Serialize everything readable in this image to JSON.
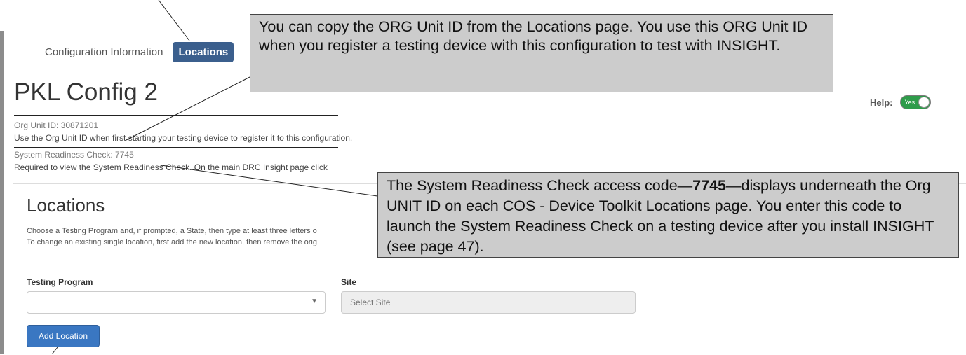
{
  "tabs": [
    {
      "label": "Configuration Information",
      "active": false
    },
    {
      "label": "Locations",
      "active": true
    }
  ],
  "page_title": "PKL Config 2",
  "help": {
    "label": "Help:",
    "toggle_text": "Yes"
  },
  "org_unit": {
    "id_line": "Org Unit ID: 30871201",
    "note": "Use the Org Unit ID when first starting your testing device to register it to this configuration."
  },
  "system_readiness": {
    "line": "System Readiness Check: 7745",
    "note": "Required to view the System Readiness Check. On the main DRC Insight page click"
  },
  "locations": {
    "title": "Locations",
    "desc_line1": "Choose a Testing Program and, if prompted, a State, then type at least three letters o",
    "desc_line2": "To change an existing single location, first add the new location, then remove the orig"
  },
  "form": {
    "testing_program_label": "Testing Program",
    "site_label": "Site",
    "site_placeholder": "Select Site",
    "add_button": "Add Location"
  },
  "callouts": {
    "c1": "You can copy the ORG Unit ID from the Locations page. You use this ORG Unit ID when you register a testing device with this configuration to test with INSIGHT.",
    "c2_before": "The System Readiness Check access code—",
    "c2_code": "7745",
    "c2_after": "—displays underneath the Org UNIT ID on each COS - Device Toolkit Locations page. You enter this code to launch the System Readiness Check on a testing device after you install INSIGHT (see page 47)."
  },
  "colors": {
    "active_tab": "#3b5f8d",
    "button": "#3a77c2",
    "toggle": "#2e9c4a",
    "callout_bg": "#cccccc"
  }
}
